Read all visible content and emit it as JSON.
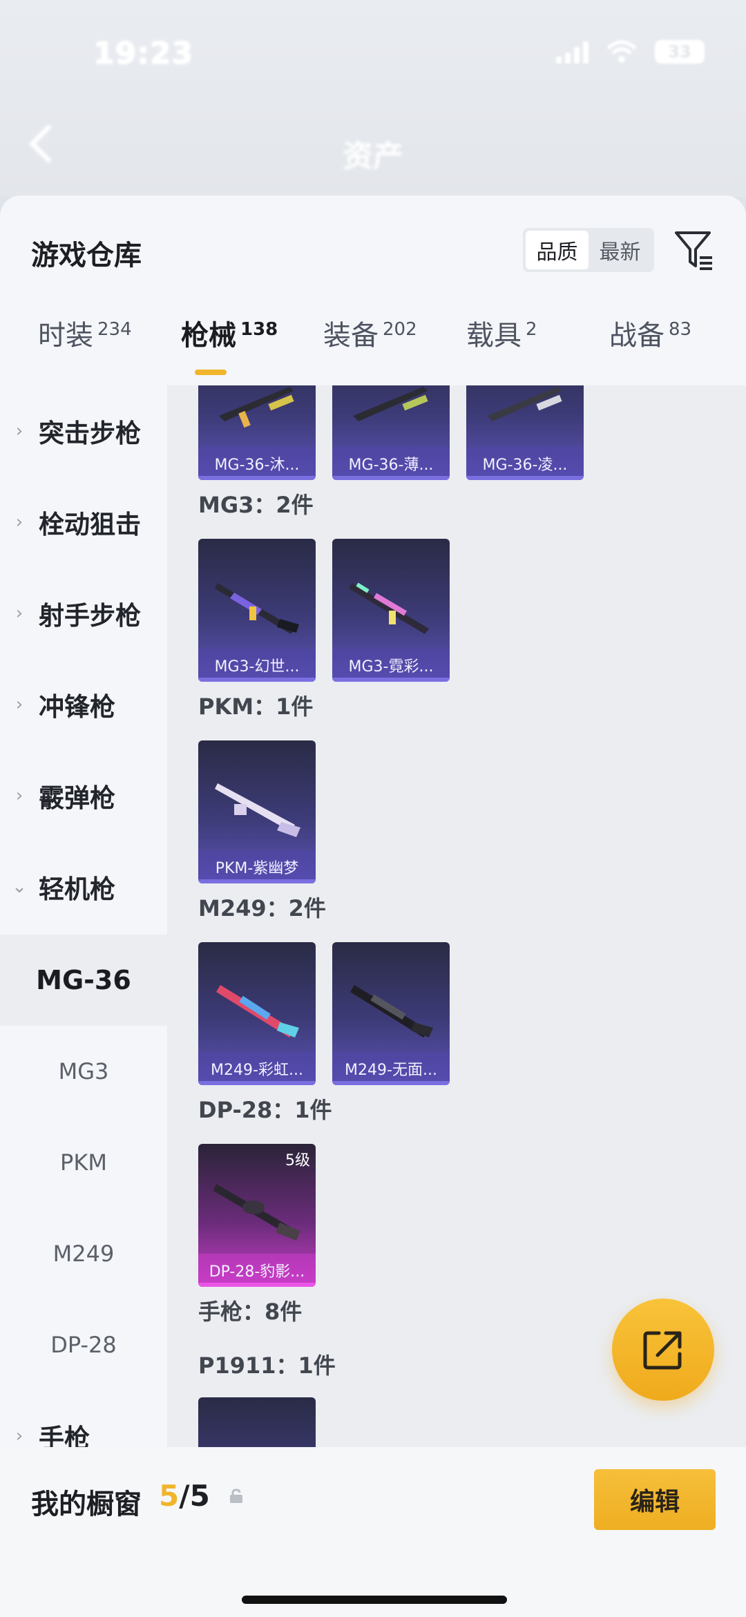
{
  "status": {
    "time": "19:23",
    "battery": "33"
  },
  "nav": {
    "title": "资产"
  },
  "header": {
    "title": "游戏仓库",
    "sort_quality": "品质",
    "sort_latest": "最新"
  },
  "tabs": [
    {
      "label": "时装",
      "count": "234"
    },
    {
      "label": "枪械",
      "count": "138"
    },
    {
      "label": "装备",
      "count": "202"
    },
    {
      "label": "载具",
      "count": "2"
    },
    {
      "label": "战备",
      "count": "83"
    }
  ],
  "sidebar": [
    {
      "label": "突击步枪"
    },
    {
      "label": "栓动狙击"
    },
    {
      "label": "射手步枪"
    },
    {
      "label": "冲锋枪"
    },
    {
      "label": "霰弹枪"
    },
    {
      "label": "轻机枪"
    },
    {
      "label": "MG-36"
    },
    {
      "label": "MG3"
    },
    {
      "label": "PKM"
    },
    {
      "label": "M249"
    },
    {
      "label": "DP-28"
    },
    {
      "label": "手枪"
    }
  ],
  "groups": {
    "mg36": {
      "cards": [
        "MG-36-沐...",
        "MG-36-薄...",
        "MG-36-凌..."
      ]
    },
    "mg3": {
      "label": "MG3：2件",
      "cards": [
        "MG3-幻世...",
        "MG3-霓彩..."
      ]
    },
    "pkm": {
      "label": "PKM：1件",
      "cards": [
        "PKM-紫幽梦"
      ]
    },
    "m249": {
      "label": "M249：2件",
      "cards": [
        "M249-彩虹...",
        "M249-无面..."
      ]
    },
    "dp28": {
      "label": "DP-28：1件",
      "cards": [
        "DP-28-豹影..."
      ],
      "level": "5级"
    },
    "pistol": {
      "label": "手枪：8件"
    },
    "p1911": {
      "label": "P1911：1件"
    }
  },
  "showcase": {
    "title": "我的橱窗",
    "current": "5",
    "total": "/5",
    "edit_label": "编辑"
  },
  "icons": {
    "back": "back-chevron-icon",
    "filter": "filter-icon",
    "share": "share-external-icon",
    "lock": "lock-icon"
  },
  "colors": {
    "accent": "#f1b52d",
    "card_purple": "#5e55b8",
    "card_pink": "#cc3fc8"
  }
}
